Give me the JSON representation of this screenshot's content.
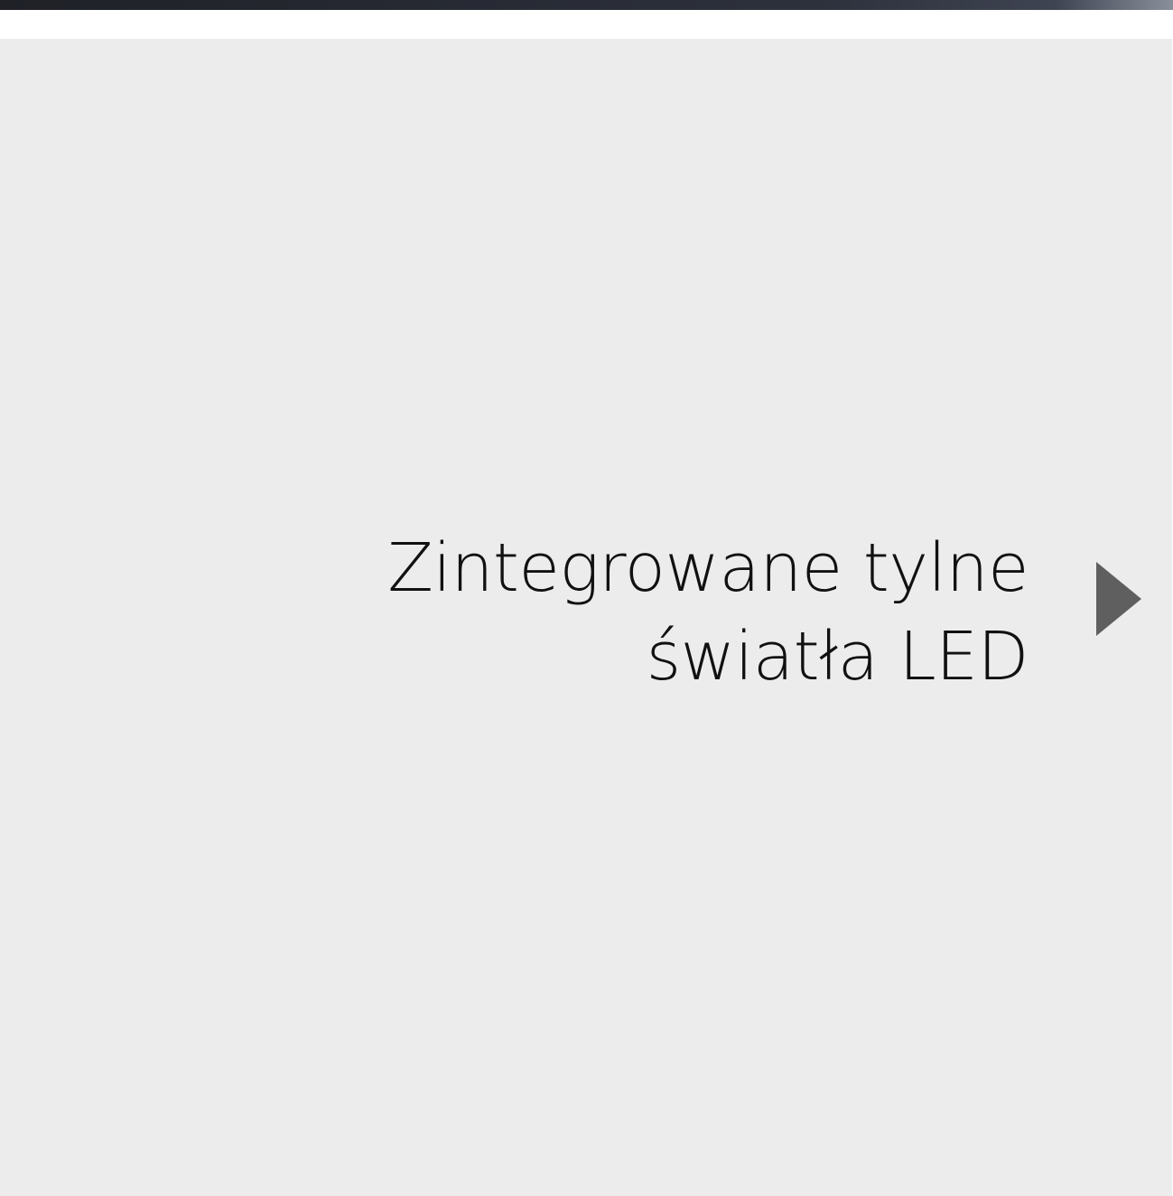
{
  "banner": {
    "colors": [
      "#1f2127",
      "#2d313c",
      "#8a8f9c"
    ]
  },
  "panel": {
    "background": "#ececec",
    "caption_lines": [
      "Zintegrowane tylne",
      "światła LED"
    ]
  },
  "navigation": {
    "next_icon": "play-triangle-right",
    "icon_color": "#5f5f5f"
  }
}
